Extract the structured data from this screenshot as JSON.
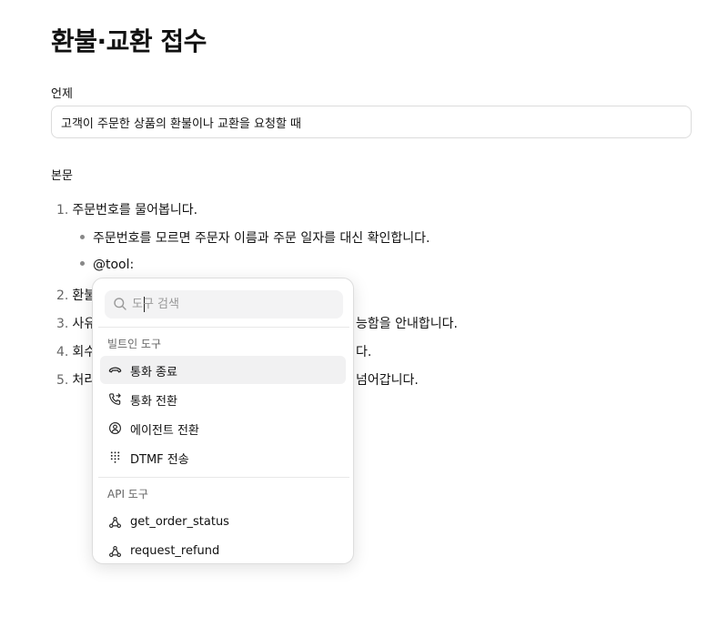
{
  "page": {
    "title": "환불·교환 접수"
  },
  "when": {
    "label": "언제",
    "value": "고객이 주문한 상품의 환불이나 교환을 요청할 때"
  },
  "body": {
    "label": "본문",
    "step1": {
      "num": "1.",
      "text": "주문번호를 물어봅니다."
    },
    "sub1": "주문번호를 모르면 주문자 이름과 주문 일자를 대신 확인합니다.",
    "sub2": "@tool:",
    "step2": {
      "num": "2.",
      "text": "환불"
    },
    "step3": {
      "num": "3.",
      "text_left": "사유",
      "text_right": "능함을 안내합니다."
    },
    "step4": {
      "num": "4.",
      "text_left": "회수",
      "text_right": "다."
    },
    "step5": {
      "num": "5.",
      "text_left": "처리",
      "text_right": "넘어갑니다."
    }
  },
  "popup": {
    "search_placeholder": "도구 검색",
    "builtin": {
      "title": "빌트인 도구",
      "items": [
        {
          "label": "통화 종료",
          "icon": "phone-hangup-icon"
        },
        {
          "label": "통화 전환",
          "icon": "phone-forward-icon"
        },
        {
          "label": "에이전트 전환",
          "icon": "agent-transfer-icon"
        },
        {
          "label": "DTMF 전송",
          "icon": "keypad-icon"
        }
      ]
    },
    "api": {
      "title": "API 도구",
      "items": [
        {
          "label": "get_order_status",
          "icon": "webhook-icon"
        },
        {
          "label": "request_refund",
          "icon": "webhook-icon"
        }
      ]
    }
  }
}
